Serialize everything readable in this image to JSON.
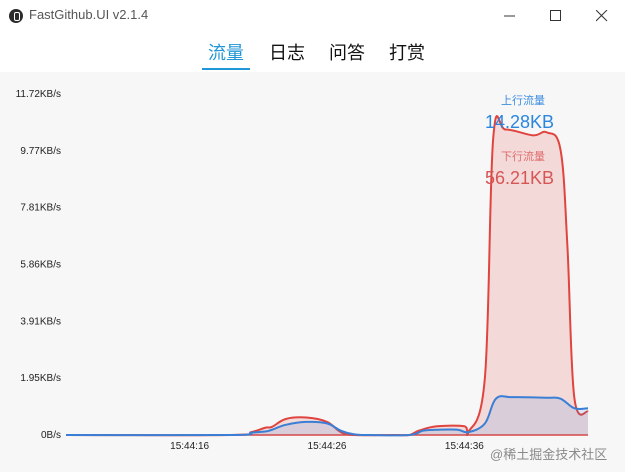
{
  "window": {
    "title": "FastGithub.UI v2.1.4",
    "icon": "fastgithub-logo-icon"
  },
  "tabs": [
    {
      "label": "流量",
      "active": true
    },
    {
      "label": "日志",
      "active": false
    },
    {
      "label": "问答",
      "active": false
    },
    {
      "label": "打赏",
      "active": false
    }
  ],
  "stats": {
    "upload_label": "上行流量",
    "upload_value": "14.28KB",
    "download_label": "下行流量",
    "download_value": "56.21KB"
  },
  "watermark": "@稀土掘金技术社区",
  "colors": {
    "accent": "#2196d6",
    "upload": "#3a7fd5",
    "download": "#e0443f"
  },
  "chart_data": {
    "type": "area",
    "y_ticks": [
      "0B/s",
      "1.95KB/s",
      "3.91KB/s",
      "5.86KB/s",
      "7.81KB/s",
      "9.77KB/s",
      "11.72KB/s"
    ],
    "ylim": [
      0,
      11.72
    ],
    "y_unit": "KB/s",
    "x_ticks": [
      "15:44:16",
      "15:44:26",
      "15:44:36"
    ],
    "x_tick_positions": [
      16,
      26,
      36
    ],
    "xlim": [
      7,
      45
    ],
    "series": [
      {
        "name": "上行流量",
        "color": "#3a7fd5",
        "points": [
          [
            7,
            0
          ],
          [
            19,
            0
          ],
          [
            20.5,
            0.08
          ],
          [
            21.5,
            0.12
          ],
          [
            22,
            0.18
          ],
          [
            23,
            0.35
          ],
          [
            24.5,
            0.45
          ],
          [
            26,
            0.4
          ],
          [
            27,
            0.15
          ],
          [
            28,
            0.02
          ],
          [
            29,
            0
          ],
          [
            32,
            0
          ],
          [
            33,
            0.15
          ],
          [
            34,
            0.18
          ],
          [
            35.5,
            0.18
          ],
          [
            36.3,
            0.1
          ],
          [
            37.5,
            0.4
          ],
          [
            38.3,
            1.25
          ],
          [
            39.5,
            1.3
          ],
          [
            42,
            1.28
          ],
          [
            43,
            1.25
          ],
          [
            44,
            0.92
          ],
          [
            45,
            0.92
          ]
        ]
      },
      {
        "name": "下行流量",
        "color": "#e0443f",
        "points": [
          [
            7,
            0
          ],
          [
            19,
            0
          ],
          [
            20.5,
            0.1
          ],
          [
            21.5,
            0.25
          ],
          [
            22,
            0.28
          ],
          [
            23,
            0.55
          ],
          [
            24.5,
            0.6
          ],
          [
            26,
            0.45
          ],
          [
            27,
            0.1
          ],
          [
            28,
            0
          ],
          [
            31,
            0
          ],
          [
            32,
            0
          ],
          [
            32.7,
            0.15
          ],
          [
            34,
            0.3
          ],
          [
            36,
            0.3
          ],
          [
            36.3,
            0.1
          ],
          [
            37.5,
            2
          ],
          [
            38.1,
            10.2
          ],
          [
            39,
            10.5
          ],
          [
            41,
            10.3
          ],
          [
            42,
            10.4
          ],
          [
            43,
            9.8
          ],
          [
            43.5,
            6.5
          ],
          [
            44,
            1.3
          ],
          [
            45,
            0.8
          ]
        ]
      }
    ],
    "grid": false,
    "legend": "top-right labels"
  }
}
